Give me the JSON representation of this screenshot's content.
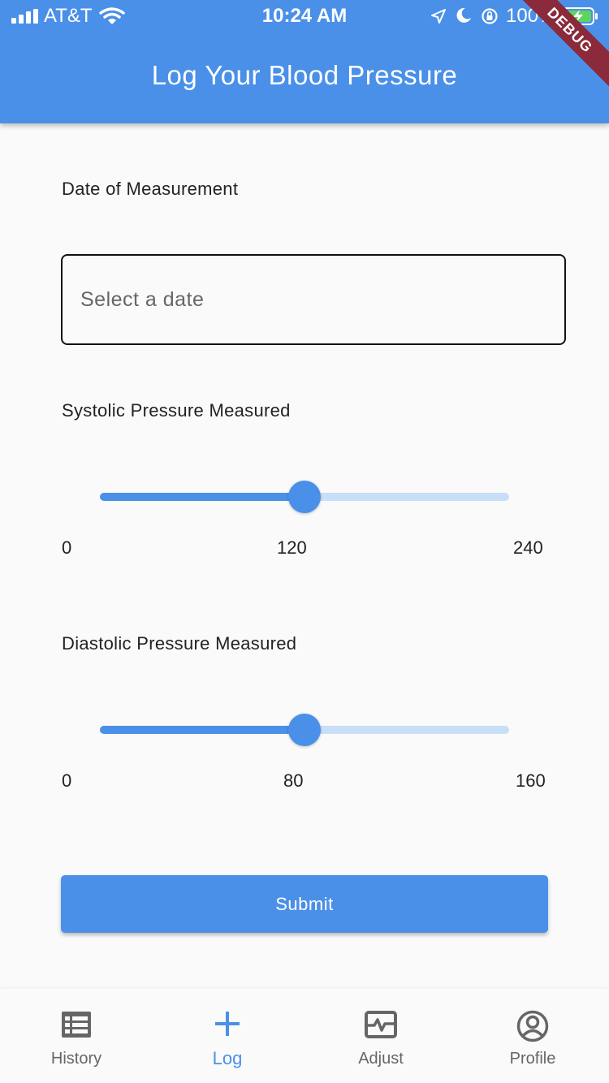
{
  "status_bar": {
    "carrier": "AT&T",
    "time": "10:24 AM",
    "battery": "100%"
  },
  "app_bar": {
    "title": "Log Your Blood Pressure",
    "debug_label": "DEBUG",
    "color": "#4a90e8"
  },
  "form": {
    "date": {
      "label": "Date of Measurement",
      "placeholder": "Select a date",
      "value": ""
    },
    "systolic": {
      "label": "Systolic Pressure Measured",
      "min": 0,
      "max": 240,
      "value": 120,
      "min_label": "0",
      "value_label": "120",
      "max_label": "240"
    },
    "diastolic": {
      "label": "Diastolic Pressure Measured",
      "min": 0,
      "max": 160,
      "value": 80,
      "min_label": "0",
      "value_label": "80",
      "max_label": "160"
    },
    "submit_label": "Submit"
  },
  "bottom_nav": {
    "active": "log",
    "items": [
      {
        "label": "History",
        "icon": "list-icon"
      },
      {
        "label": "Log",
        "icon": "plus-icon"
      },
      {
        "label": "Adjust",
        "icon": "pulse-chart-icon"
      },
      {
        "label": "Profile",
        "icon": "account-circle-icon"
      }
    ]
  }
}
